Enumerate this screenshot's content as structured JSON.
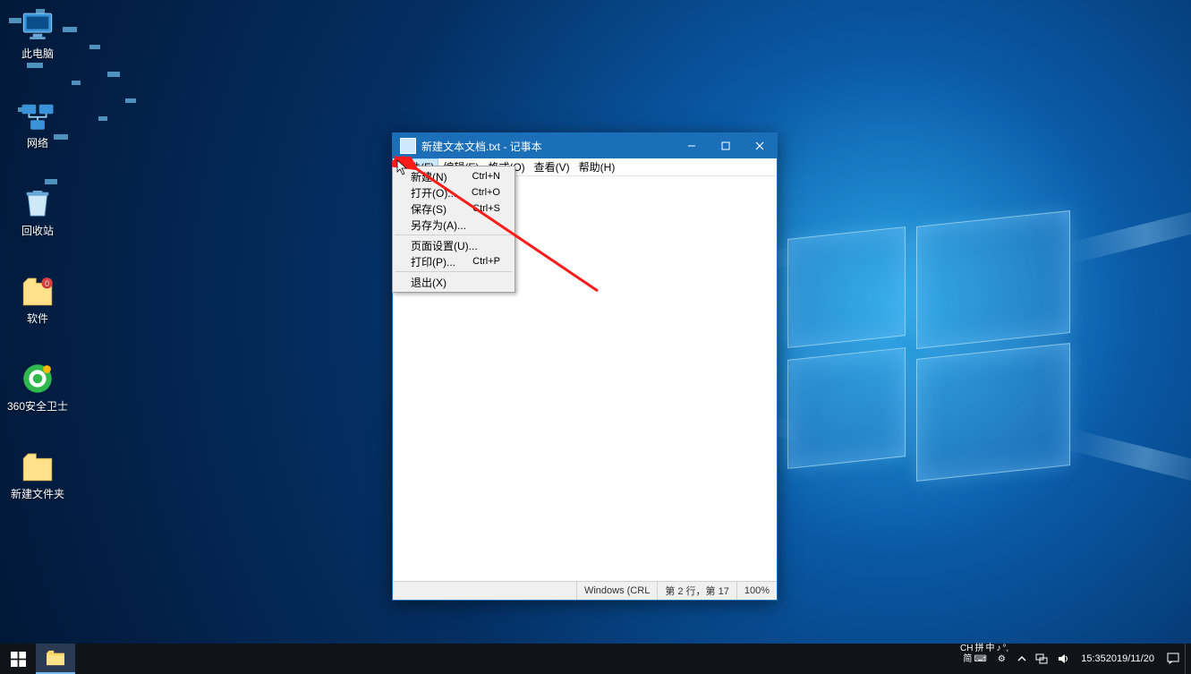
{
  "desktop_icons": [
    {
      "name": "此电脑"
    },
    {
      "name": "网络"
    },
    {
      "name": "回收站"
    },
    {
      "name": "软件"
    },
    {
      "name": "360安全卫士"
    },
    {
      "name": "新建文件夹"
    }
  ],
  "notepad": {
    "title": "新建文本文档.txt - 记事本",
    "menu": {
      "file": "文件(F)",
      "edit": "编辑(E)",
      "format": "格式(O)",
      "view": "查看(V)",
      "help": "帮助(H)"
    },
    "status": {
      "encoding": "Windows (CRL",
      "pos": "第 2 行，第 17",
      "zoom": "100%"
    }
  },
  "filemenu": [
    {
      "label": "新建(N)",
      "shortcut": "Ctrl+N"
    },
    {
      "label": "打开(O)...",
      "shortcut": "Ctrl+O"
    },
    {
      "label": "保存(S)",
      "shortcut": "Ctrl+S"
    },
    {
      "label": "另存为(A)...",
      "shortcut": ""
    },
    {
      "sep": true
    },
    {
      "label": "页面设置(U)...",
      "shortcut": ""
    },
    {
      "label": "打印(P)...",
      "shortcut": "Ctrl+P"
    },
    {
      "sep": true
    },
    {
      "label": "退出(X)",
      "shortcut": ""
    }
  ],
  "tray": {
    "ime_lang": "CH",
    "ime_method": "拼",
    "ime_zhong": "中",
    "ime_punct": "♪",
    "ime_full": "°,",
    "ime_jian": "简",
    "ime_soft": "⌨",
    "ime_set": "⚙",
    "time": "15:35",
    "date": "2019/11/20"
  }
}
